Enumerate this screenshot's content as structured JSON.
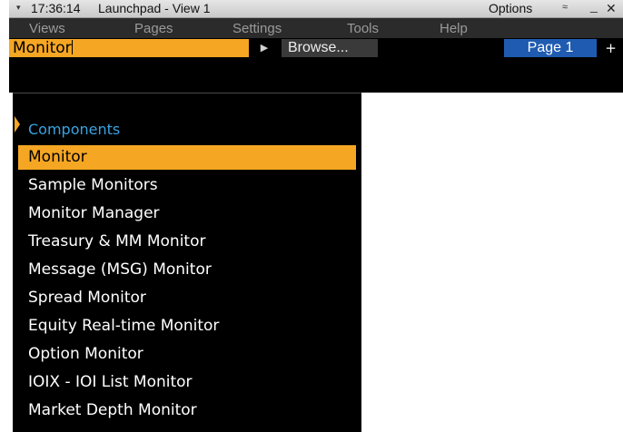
{
  "titlebar": {
    "time": "17:36:14",
    "title": "Launchpad - View 1",
    "options_label": "Options",
    "collapse_glyph": "≈",
    "minimize_glyph": "_",
    "close_glyph": "✕",
    "menu_glyph": "▾"
  },
  "menubar": {
    "items": [
      {
        "label": "Views"
      },
      {
        "label": "Pages"
      },
      {
        "label": "Settings"
      },
      {
        "label": "Tools"
      },
      {
        "label": "Help"
      }
    ]
  },
  "command": {
    "value": "Monitor",
    "play_glyph": "▶",
    "browse_label": "Browse...",
    "page_label": "Page 1",
    "add_page_glyph": "+"
  },
  "dropdown": {
    "heading": "Components",
    "selected_index": 0,
    "items": [
      {
        "label": "Monitor"
      },
      {
        "label": "Sample Monitors"
      },
      {
        "label": "Monitor Manager"
      },
      {
        "label": "Treasury & MM Monitor"
      },
      {
        "label": "Message (MSG) Monitor"
      },
      {
        "label": "Spread Monitor"
      },
      {
        "label": "Equity Real-time Monitor"
      },
      {
        "label": "Option Monitor"
      },
      {
        "label": "IOIX - IOI List Monitor"
      },
      {
        "label": "Market Depth Monitor"
      }
    ]
  },
  "colors": {
    "accent_orange": "#f5a623",
    "heading_blue": "#3aa3e0",
    "page_blue": "#1f5bb0"
  }
}
